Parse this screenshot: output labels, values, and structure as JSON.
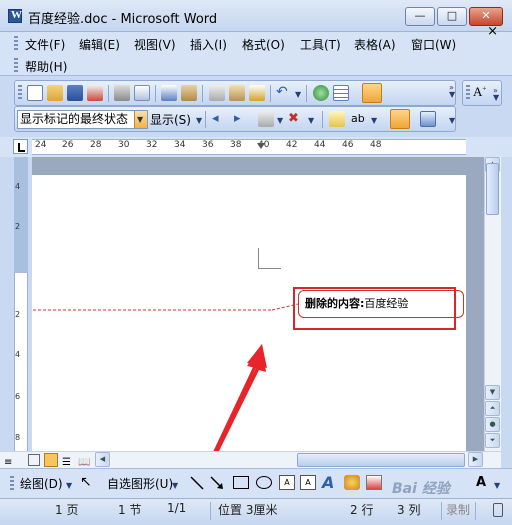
{
  "window": {
    "title": "百度经验.doc - Microsoft Word"
  },
  "menu": {
    "items": [
      "文件(F)",
      "编辑(E)",
      "视图(V)",
      "插入(I)",
      "格式(O)",
      "工具(T)",
      "表格(A)",
      "窗口(W)",
      "帮助(H)"
    ],
    "close": "×"
  },
  "review_toolbar": {
    "display_for_review": "显示标记的最终状态",
    "show_menu": "显示(S)"
  },
  "ruler": {
    "numbers": [
      "24",
      "26",
      "28",
      "30",
      "32",
      "34",
      "36",
      "38",
      "40",
      "42",
      "44",
      "46",
      "48"
    ]
  },
  "vertical_ruler": {
    "numbers": [
      "4",
      "2",
      "2",
      "4",
      "6",
      "8"
    ]
  },
  "comment": {
    "label": "删除的内容:",
    "text": "百度经验"
  },
  "drawing_toolbar": {
    "draw_menu": "绘图(D)",
    "autoshapes": "自选图形(U)"
  },
  "statusbar": {
    "page": "1 页",
    "section": "1 节",
    "page_of": "1/1",
    "position": "位置 3厘米",
    "line": "2 行",
    "column": "3 列",
    "record": "录制"
  },
  "watermark": "Bai 经验",
  "colors": {
    "change_line": "#c0392b",
    "highlight": "#d9262c",
    "arrow": "#e8242a"
  }
}
